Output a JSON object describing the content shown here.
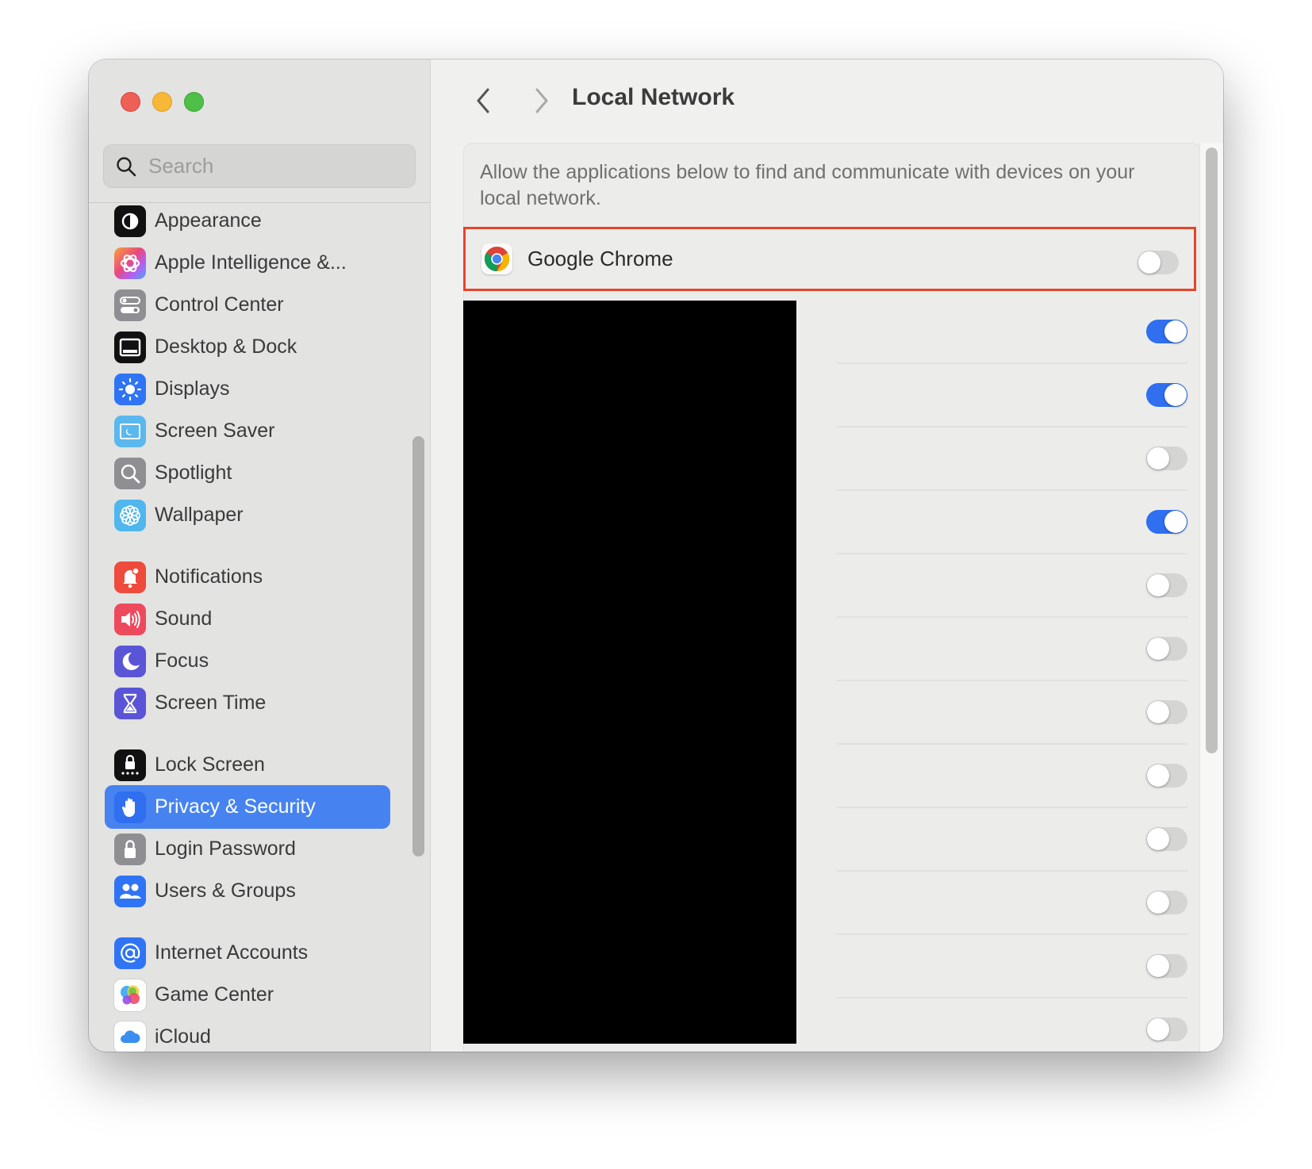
{
  "window": {
    "traffic_lights": [
      "close",
      "minimize",
      "zoom"
    ]
  },
  "sidebar": {
    "search_placeholder": "Search",
    "search_value": "",
    "items": [
      {
        "label": "Appearance",
        "icon": "appearance-icon",
        "color": "#111111",
        "partial": true
      },
      {
        "label": "Apple Intelligence &...",
        "icon": "apple-intelligence-icon",
        "color": "#e35db5"
      },
      {
        "label": "Control Center",
        "icon": "control-center-icon",
        "color": "#8e8e93"
      },
      {
        "label": "Desktop & Dock",
        "icon": "desktop-dock-icon",
        "color": "#111111"
      },
      {
        "label": "Displays",
        "icon": "displays-icon",
        "color": "#2f74f5"
      },
      {
        "label": "Screen Saver",
        "icon": "screen-saver-icon",
        "color": "#5ab8ee"
      },
      {
        "label": "Spotlight",
        "icon": "spotlight-icon",
        "color": "#8e8e93"
      },
      {
        "label": "Wallpaper",
        "icon": "wallpaper-icon",
        "color": "#4fb6ee"
      },
      {
        "label": "Notifications",
        "icon": "notifications-icon",
        "color": "#ee4b3d"
      },
      {
        "label": "Sound",
        "icon": "sound-icon",
        "color": "#ee4a5e"
      },
      {
        "label": "Focus",
        "icon": "focus-icon",
        "color": "#5a55d6"
      },
      {
        "label": "Screen Time",
        "icon": "screen-time-icon",
        "color": "#5a55d6"
      },
      {
        "label": "Lock Screen",
        "icon": "lock-screen-icon",
        "color": "#111111"
      },
      {
        "label": "Privacy & Security",
        "icon": "privacy-hand-icon",
        "color": "#2f6ff0",
        "selected": true
      },
      {
        "label": "Login Password",
        "icon": "login-password-icon",
        "color": "#8e8e93"
      },
      {
        "label": "Users & Groups",
        "icon": "users-groups-icon",
        "color": "#2f74f5"
      },
      {
        "label": "Internet Accounts",
        "icon": "internet-accounts-icon",
        "color": "#2f74f5"
      },
      {
        "label": "Game Center",
        "icon": "game-center-icon",
        "color": "#ffffff"
      },
      {
        "label": "iCloud",
        "icon": "icloud-icon",
        "color": "#ffffff",
        "partial": true
      }
    ]
  },
  "main": {
    "title": "Local Network",
    "nav_back": "back",
    "nav_forward": "forward",
    "description": "Allow the applications below to find and communicate with devices on your local network.",
    "highlighted_app": {
      "name": "Google Chrome",
      "enabled": false
    },
    "redacted_apps": [
      {
        "enabled": true
      },
      {
        "enabled": true
      },
      {
        "enabled": false
      },
      {
        "enabled": true
      },
      {
        "enabled": false
      },
      {
        "enabled": false
      },
      {
        "enabled": false
      },
      {
        "enabled": false
      },
      {
        "enabled": false
      },
      {
        "enabled": false
      },
      {
        "enabled": false
      },
      {
        "enabled": false
      }
    ]
  },
  "colors": {
    "accent": "#2f6ff0",
    "selection": "#4783f0",
    "highlight_border": "#e8432a",
    "redaction": "#000000"
  }
}
